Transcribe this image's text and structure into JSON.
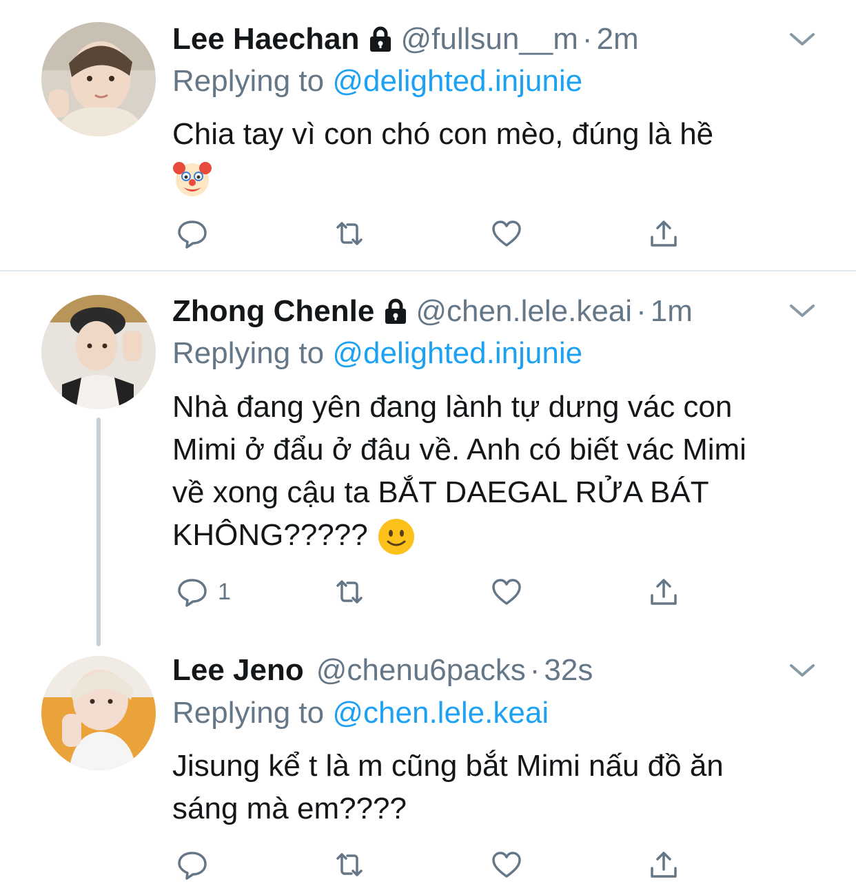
{
  "colors": {
    "link": "#1da1f2",
    "muted": "#657786",
    "text": "#14171a",
    "divider": "#e1e8ed",
    "thread_line": "#c4cfd6"
  },
  "tweets": [
    {
      "name": "Lee Haechan",
      "locked": true,
      "handle": "@fullsun__m",
      "dot": "·",
      "time": "2m",
      "replying_prefix": "Replying to ",
      "replying_to": "@delighted.injunie",
      "text": "Chia tay vì con chó con mèo, đúng là hề",
      "emoji": "clown-face",
      "replies": "",
      "icons": [
        "reply-icon",
        "retweet-icon",
        "like-icon",
        "share-icon"
      ]
    },
    {
      "name": "Zhong Chenle",
      "locked": true,
      "handle": "@chen.lele.keai",
      "dot": "·",
      "time": "1m",
      "replying_prefix": "Replying to ",
      "replying_to": "@delighted.injunie",
      "text_lines": [
        "Nhà đang yên đang lành tự dưng vác con",
        "Mimi ở đẩu ở đâu về. Anh có biết vác Mimi",
        "về xong cậu ta BẮT DAEGAL RỬA BÁT",
        "KHÔNG?????"
      ],
      "emoji": "slightly-smiling-face",
      "replies": "1",
      "icons": [
        "reply-icon",
        "retweet-icon",
        "like-icon",
        "share-icon"
      ]
    },
    {
      "name": "Lee Jeno",
      "locked": false,
      "handle": "@chenu6packs",
      "dot": "·",
      "time": "32s",
      "replying_prefix": "Replying to ",
      "replying_to": "@chen.lele.keai",
      "text_lines": [
        "Jisung kể t là m cũng bắt Mimi nấu đồ ăn",
        "sáng mà em????"
      ],
      "replies": "",
      "icons": [
        "reply-icon",
        "retweet-icon",
        "like-icon",
        "share-icon"
      ]
    }
  ]
}
